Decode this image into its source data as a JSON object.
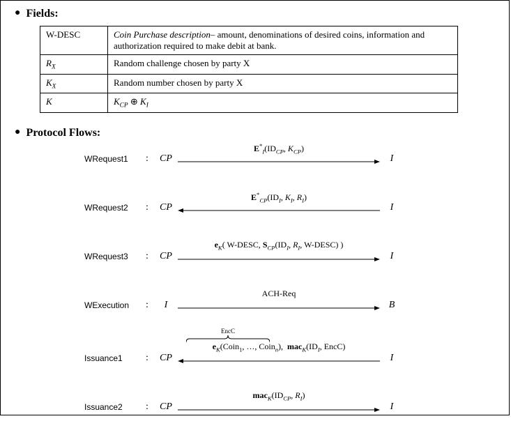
{
  "sections": {
    "fields_title": "Fields:",
    "flows_title": "Protocol Flows:"
  },
  "fields": [
    {
      "name": "W-DESC",
      "desc_prefix_italic": "Coin Purchase description",
      "desc_rest": "– amount, denominations of desired coins, information and authorization required to make debit at bank."
    },
    {
      "name_math": "R_X",
      "desc": "Random challenge chosen by party X"
    },
    {
      "name_math": "K_X",
      "desc": "Random number chosen by party X"
    },
    {
      "name_math": "K",
      "desc_math": "K_CP ⊕ K_I"
    }
  ],
  "flows": [
    {
      "name": "WRequest1",
      "left": "CP",
      "right": "I",
      "dir": "right",
      "label": "E*_I(ID_CP, K_CP)"
    },
    {
      "name": "WRequest2",
      "left": "CP",
      "right": "I",
      "dir": "left",
      "label": "E*_CP(ID_I, K_I, R_I)"
    },
    {
      "name": "WRequest3",
      "left": "CP",
      "right": "I",
      "dir": "right",
      "label": "e_K( W-DESC, S_CP(ID_I, R_I, W-DESC) )"
    },
    {
      "name": "WExecution",
      "left": "I",
      "right": "B",
      "dir": "right",
      "label": "ACH-Req"
    },
    {
      "name": "Issuance1",
      "left": "CP",
      "right": "I",
      "dir": "left",
      "label": "e_K(Coin_1, …, Coin_n),  mac_K(ID_I, EncC)",
      "brace": "EncC"
    },
    {
      "name": "Issuance2",
      "left": "CP",
      "right": "I",
      "dir": "right",
      "label": "mac_K(ID_CP, R_I)"
    }
  ]
}
